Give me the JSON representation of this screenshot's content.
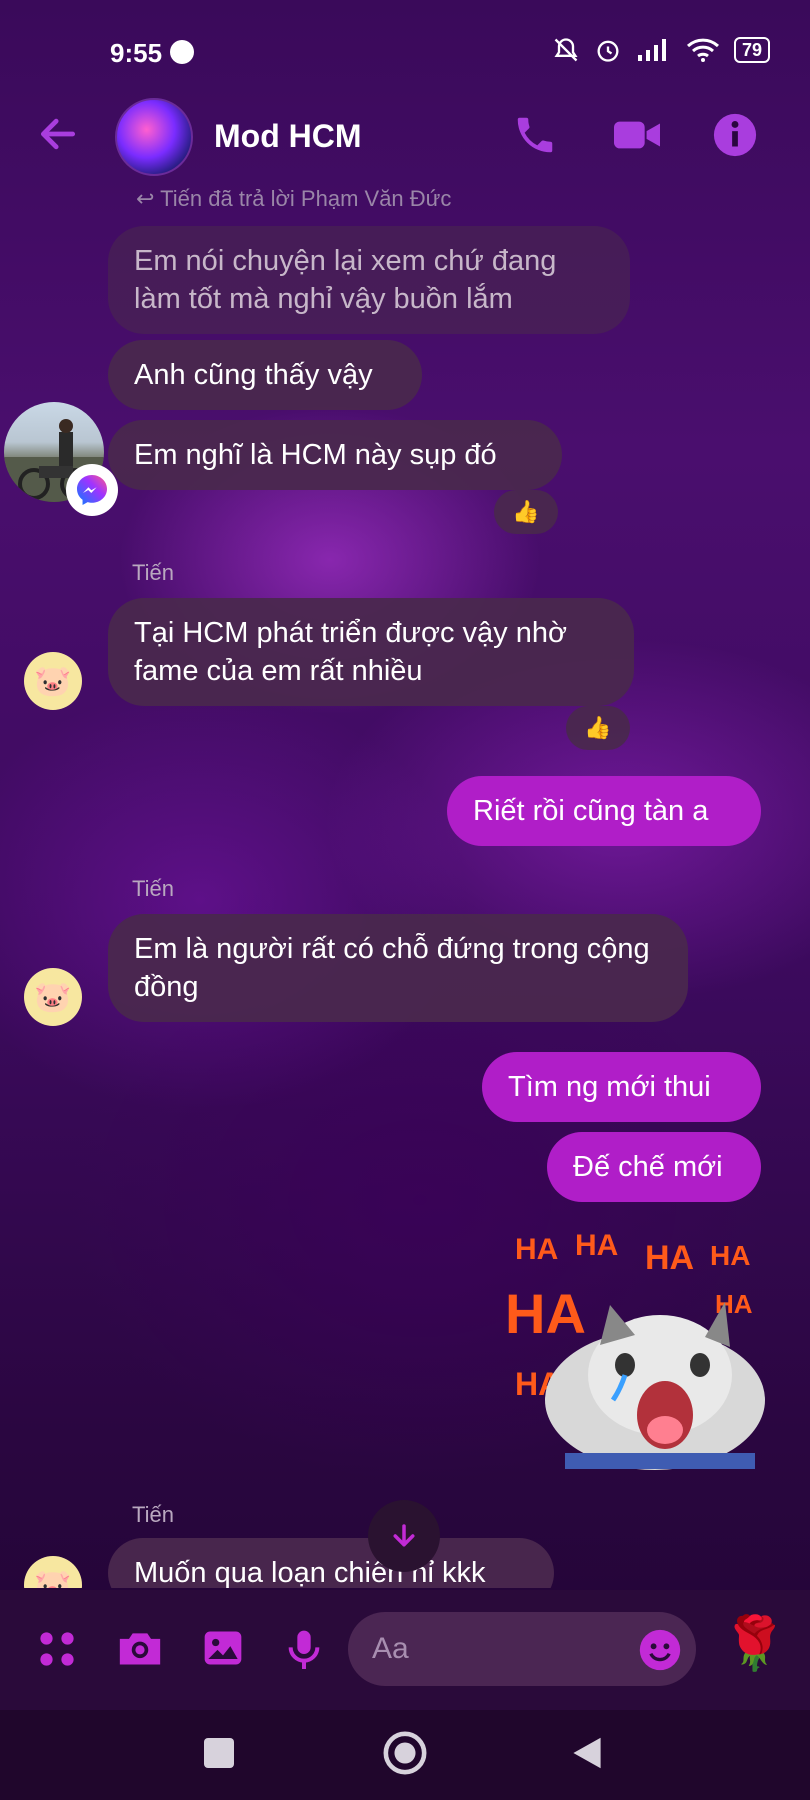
{
  "status_bar": {
    "time": "9:55",
    "battery": "79"
  },
  "header": {
    "title": "Mod HCM"
  },
  "reply_note": "Tiến đã trả lời Phạm Văn Đức",
  "messages": {
    "m1": "Em nói chuyện lại xem chứ đang làm tốt mà nghỉ vậy buồn lắm",
    "m2": "Anh cũng thấy vậy",
    "m3": "Em nghĩ là HCM này sụp đó",
    "m4": "Tại HCM phát triển được vậy nhờ fame của em rất nhiều",
    "m5": "Riết rồi cũng tàn a",
    "m6": "Em là người rất có chỗ đứng trong cộng đồng",
    "m7": "Tìm ng mới thui",
    "m8": "Đế chế mới",
    "m9": "Muốn qua loạn chiến hỉ kkk"
  },
  "sender_name": "Tiến",
  "reaction_emoji": "👍",
  "sticker_text": "HA",
  "composer": {
    "placeholder": "Aa"
  },
  "quick_reaction": "🌹",
  "colors": {
    "accent": "#a93dde",
    "mine_bubble": "#b01ec8",
    "other_bubble": "#4a284e"
  },
  "icons": [
    "back-arrow-icon",
    "phone-icon",
    "video-icon",
    "info-icon",
    "apps-icon",
    "camera-icon",
    "gallery-icon",
    "mic-icon",
    "emoji-icon",
    "rose-icon",
    "scroll-down-icon"
  ]
}
